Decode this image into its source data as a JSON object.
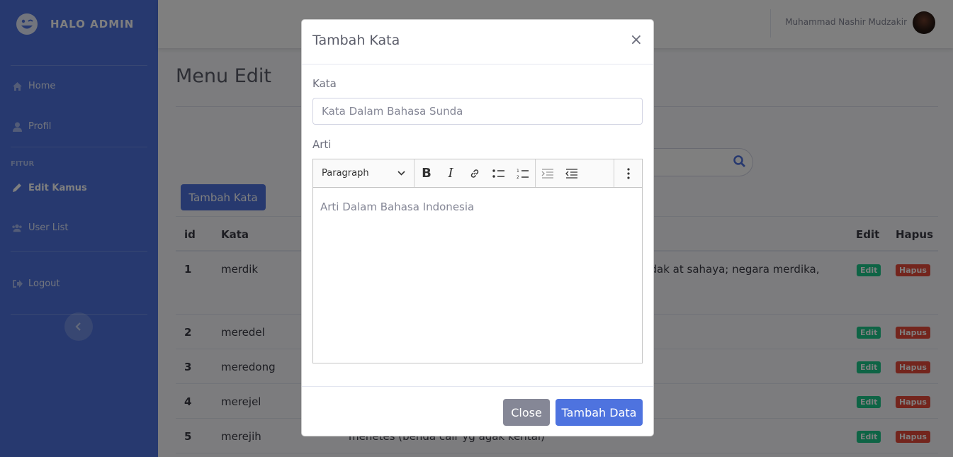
{
  "brand": {
    "name": "HALO ADMIN",
    "logo_icon": "laugh-wink-icon"
  },
  "sidebar": {
    "items": [
      {
        "label": "Home",
        "icon": "home-icon"
      },
      {
        "label": "Profil",
        "icon": "user-icon"
      }
    ],
    "heading": "FITUR",
    "feature_items": [
      {
        "label": "Edit Kamus",
        "icon": "pencil-icon",
        "active": true
      },
      {
        "label": "User List",
        "icon": "users-icon"
      }
    ],
    "logout": {
      "label": "Logout",
      "icon": "sign-out-icon"
    },
    "toggle_icon": "chevron-left-icon"
  },
  "topbar": {
    "user_name": "Muhammad Nashir Mudzakir"
  },
  "page": {
    "title": "Menu Edit",
    "add_button": "Tambah Kata",
    "table": {
      "headers": [
        "id",
        "Kata",
        "Edit",
        "Hapus"
      ],
      "rows": [
        {
          "id": "1",
          "kata": "merdik",
          "arti": "udak at sahaya; negara merdika,",
          "edit": "Edit",
          "hapus": "Hapus"
        },
        {
          "id": "2",
          "kata": "meredel",
          "arti": "",
          "edit": "Edit",
          "hapus": "Hapus"
        },
        {
          "id": "3",
          "kata": "meredong",
          "arti": "",
          "edit": "Edit",
          "hapus": "Hapus"
        },
        {
          "id": "4",
          "kata": "merejel",
          "arti": "",
          "edit": "Edit",
          "hapus": "Hapus"
        },
        {
          "id": "5",
          "kata": "merejih",
          "arti": "menetes (benda cair yg agak kental)",
          "edit": "Edit",
          "hapus": "Hapus"
        }
      ]
    }
  },
  "modal": {
    "title": "Tambah Kata",
    "close_symbol": "×",
    "kata_label": "Kata",
    "kata_placeholder": "Kata Dalam Bahasa Sunda",
    "arti_label": "Arti",
    "editor": {
      "paragraph_select": "Paragraph",
      "tools": [
        "bold-icon",
        "italic-icon",
        "link-icon",
        "bulleted-list-icon",
        "numbered-list-icon",
        "outdent-icon",
        "indent-icon",
        "more-icon"
      ],
      "placeholder": "Arti Dalam Bahasa Indonesia"
    },
    "close_button": "Close",
    "submit_button": "Tambah Data"
  },
  "colors": {
    "primary": "#4e73df",
    "success": "#1cc88a",
    "danger": "#e74a3b",
    "secondary": "#858796"
  }
}
